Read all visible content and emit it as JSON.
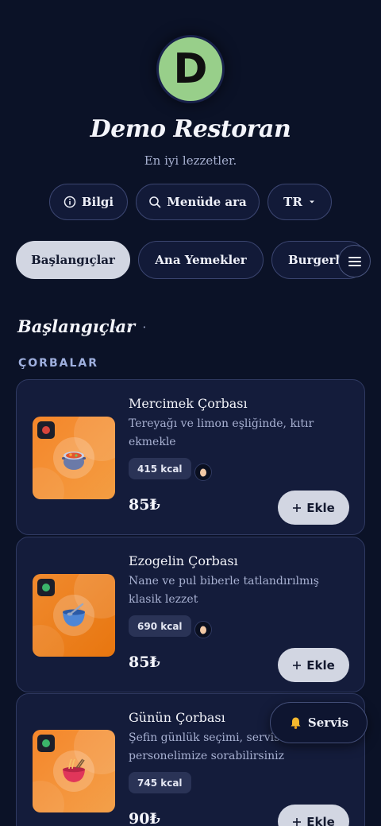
{
  "header": {
    "logo_letter": "D",
    "title": "Demo Restoran",
    "subtitle": "En iyi lezzetler."
  },
  "actions": {
    "info_label": "Bilgi",
    "search_label": "Menüde ara",
    "language_label": "TR"
  },
  "categories": [
    {
      "label": "Başlangıçlar",
      "active": true
    },
    {
      "label": "Ana Yemekler",
      "active": false
    },
    {
      "label": "Burgerler",
      "active": false
    }
  ],
  "section": {
    "title": "Başlangıçlar",
    "dots": "· · ·",
    "subcategory": "ÇORBALAR"
  },
  "items": [
    {
      "name": "Mercimek Çorbası",
      "description": "Tereyağı ve limon eşliğinde, kıtır ekmekle",
      "kcal": "415 kcal",
      "price": "85₺",
      "add_label": "Ekle",
      "diet_dot_color": "#d9453c",
      "icon": "pot-icon",
      "allergen_icon": "egg-icon"
    },
    {
      "name": "Ezogelin Çorbası",
      "description": "Nane ve pul biberle tatlandırılmış klasik lezzet",
      "kcal": "690 kcal",
      "price": "85₺",
      "add_label": "Ekle",
      "diet_dot_color": "#3bb56a",
      "icon": "bowl-icon",
      "allergen_icon": "egg-icon"
    },
    {
      "name": "Günün Çorbası",
      "description": "Şefin günlük seçimi, servis personelimize sorabilirsiniz",
      "kcal": "745 kcal",
      "price": "90₺",
      "add_label": "Ekle",
      "diet_dot_color": "#3bb56a",
      "icon": "noodle-bowl-icon"
    }
  ],
  "floating": {
    "service_label": "Servis",
    "service_icon": "bell-icon"
  },
  "colors": {
    "background": "#0b1227",
    "card": "#141c3b",
    "accent_button": "#d2d6e2",
    "logo": "#98cf8a",
    "thumb_orange": "#f08a2e"
  }
}
